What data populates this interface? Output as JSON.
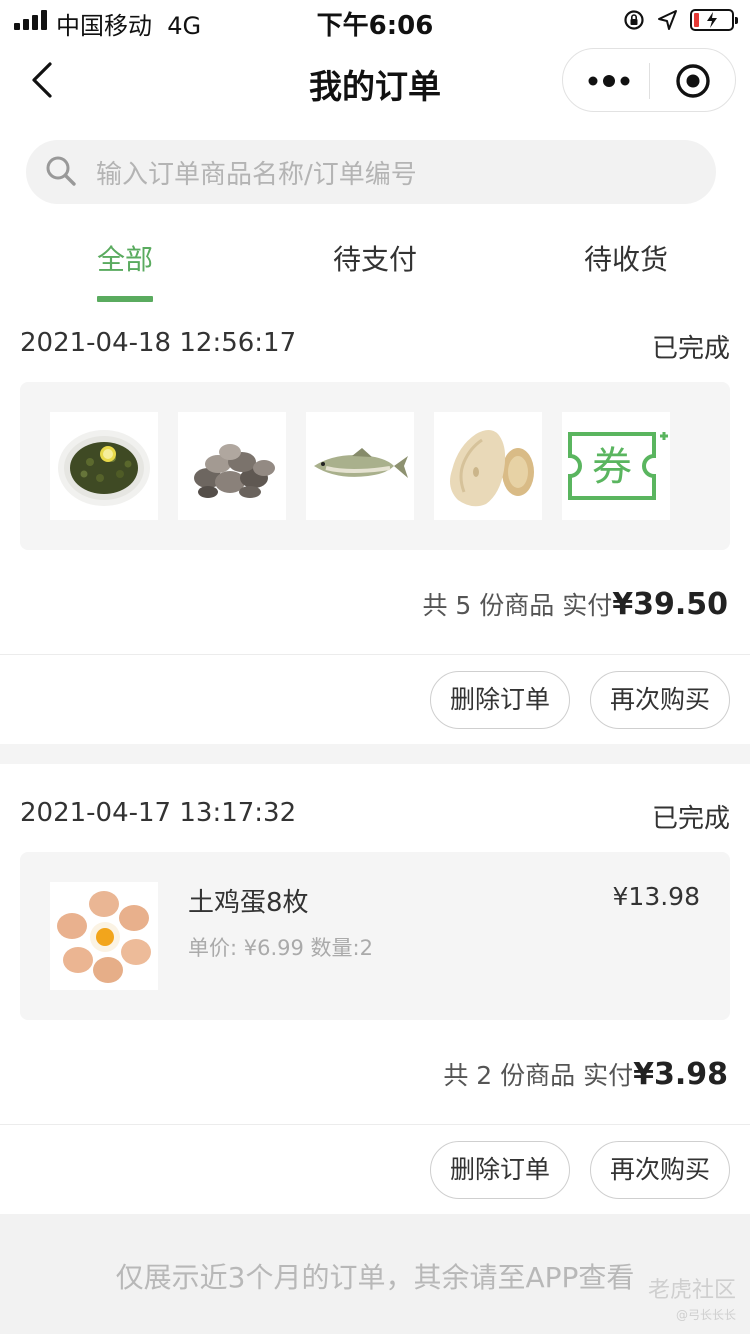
{
  "status_bar": {
    "carrier": "中国移动",
    "network": "4G",
    "time": "下午6:06",
    "battery_level": 0.12
  },
  "nav": {
    "title": "我的订单"
  },
  "search": {
    "placeholder": "输入订单商品名称/订单编号"
  },
  "tabs": [
    {
      "label": "全部",
      "active": true
    },
    {
      "label": "待支付",
      "active": false
    },
    {
      "label": "待收货",
      "active": false
    }
  ],
  "orders": [
    {
      "time": "2021-04-18 12:56:17",
      "status": "已完成",
      "thumbs": [
        "tea-leaves-image",
        "clams-image",
        "fish-image",
        "lotus-root-image",
        "coupon-image"
      ],
      "coupon_label": "券",
      "total_prefix": "共 5 份商品  实付",
      "total_amount": "¥39.50",
      "delete_label": "删除订单",
      "rebuy_label": "再次购买"
    },
    {
      "time": "2021-04-17 13:17:32",
      "status": "已完成",
      "item": {
        "name": "土鸡蛋8枚",
        "meta": "单价: ¥6.99 数量:2",
        "price": "¥13.98"
      },
      "total_prefix": "共 2 份商品  实付",
      "total_amount": "¥3.98",
      "delete_label": "删除订单",
      "rebuy_label": "再次购买"
    }
  ],
  "footer": {
    "note": "仅展示近3个月的订单，其余请至APP查看",
    "watermark": "老虎社区",
    "watermark_sub": "@弓长长长"
  },
  "colors": {
    "accent": "#5aab5f",
    "coupon": "#5ab55f"
  }
}
